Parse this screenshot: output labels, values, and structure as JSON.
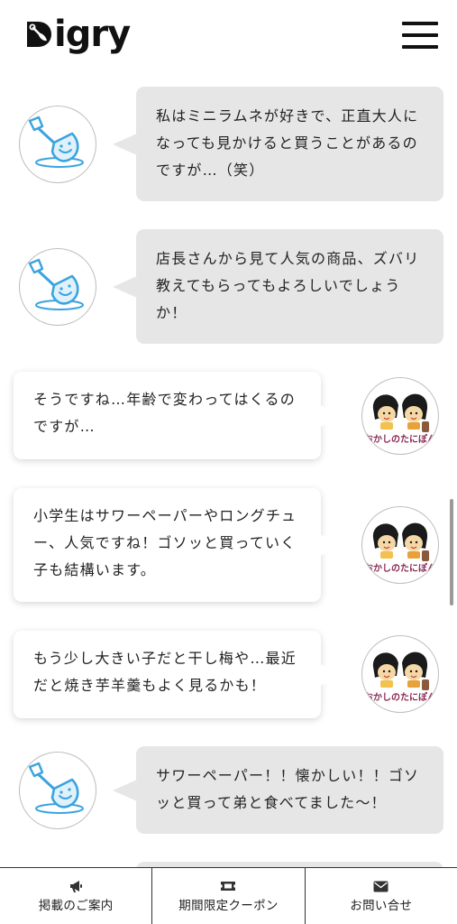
{
  "header": {
    "logo_text": "igry",
    "logo_alt": "Digry",
    "menu_icon": "hamburger-menu-icon"
  },
  "messages": [
    {
      "side": "left",
      "speaker": "interviewer",
      "avatar_icon": "shovel-icon",
      "text": "私はミニラムネが好きで、正直大人になっても見かけると買うことがあるのですが…（笑）"
    },
    {
      "side": "left",
      "speaker": "interviewer",
      "avatar_icon": "shovel-icon",
      "text": "店長さんから見て人気の商品、ズバリ教えてもらってもよろしいでしょうか！"
    },
    {
      "side": "right",
      "speaker": "shop",
      "avatar_icon": "okashi-no-tanipon-logo",
      "avatar_caption": "おかしのたにぽん",
      "text": "そうですね…年齢で変わってはくるのですが…"
    },
    {
      "side": "right",
      "speaker": "shop",
      "avatar_icon": "okashi-no-tanipon-logo",
      "avatar_caption": "おかしのたにぽん",
      "text": "小学生はサワーペーパーやロングチュー、人気ですね！ゴソッと買っていく子も結構います。"
    },
    {
      "side": "right",
      "speaker": "shop",
      "avatar_icon": "okashi-no-tanipon-logo",
      "avatar_caption": "おかしのたにぽん",
      "text": "もう少し大きい子だと干し梅や…最近だと焼き芋羊羹もよく見るかも！"
    },
    {
      "side": "left",
      "speaker": "interviewer",
      "avatar_icon": "shovel-icon",
      "text": "サワーペーパー！！懐かしい！！ゴソッと買って弟と食べてました〜！"
    }
  ],
  "bottom_nav": [
    {
      "label": "掲載のご案内",
      "icon": "megaphone-icon"
    },
    {
      "label": "期間限定クーポン",
      "icon": "ticket-icon"
    },
    {
      "label": "お問い合せ",
      "icon": "envelope-icon"
    }
  ],
  "colors": {
    "accent_blue": "#3aa3e0",
    "bubble_gray": "#e6e6e6",
    "text": "#222222",
    "brand_maroon": "#8a2a55"
  }
}
